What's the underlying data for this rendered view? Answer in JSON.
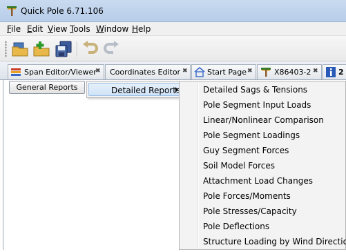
{
  "window": {
    "title": "Quick Pole 6.71.106"
  },
  "menubar": {
    "items": [
      {
        "first": "F",
        "rest": "ile"
      },
      {
        "first": "E",
        "rest": "dit"
      },
      {
        "first": "V",
        "rest": "iew"
      },
      {
        "first": "T",
        "rest": "ools"
      },
      {
        "first": "W",
        "rest": "indow"
      },
      {
        "first": "H",
        "rest": "elp"
      }
    ]
  },
  "toolbar": {
    "buttons": [
      {
        "icon": "open-folder-icon"
      },
      {
        "icon": "new-folder-icon"
      },
      {
        "icon": "save-icon"
      },
      {
        "icon": "undo-icon"
      },
      {
        "icon": "redo-icon"
      }
    ]
  },
  "tabs": [
    {
      "label": "Span Editor/Viewer",
      "icon": "span-editor-icon"
    },
    {
      "label": "Coordinates Editor"
    },
    {
      "label": "Start Page",
      "icon": "home-icon"
    },
    {
      "label": "X86403-2",
      "icon": "pole-icon"
    },
    {
      "label": "2",
      "icon": "info-icon"
    }
  ],
  "reports": {
    "general_label": "General Reports",
    "detailed_label": "Detailed Reports"
  },
  "submenu": {
    "items": [
      "Detailed Sags & Tensions",
      "Pole Segment Input Loads",
      "Linear/Nonlinear Comparison",
      "Pole Segment Loadings",
      "Guy Segment Forces",
      "Soil Model Forces",
      "Attachment Load Changes",
      "Pole Forces/Moments",
      "Pole Stresses/Capacity",
      "Pole Deflections",
      "Structure Loading by Wind Direction"
    ]
  },
  "colors": {
    "titlebar": "#c9daf0",
    "menu_highlight": "#cfe3f7",
    "menu_background": "#f3f3f3"
  }
}
